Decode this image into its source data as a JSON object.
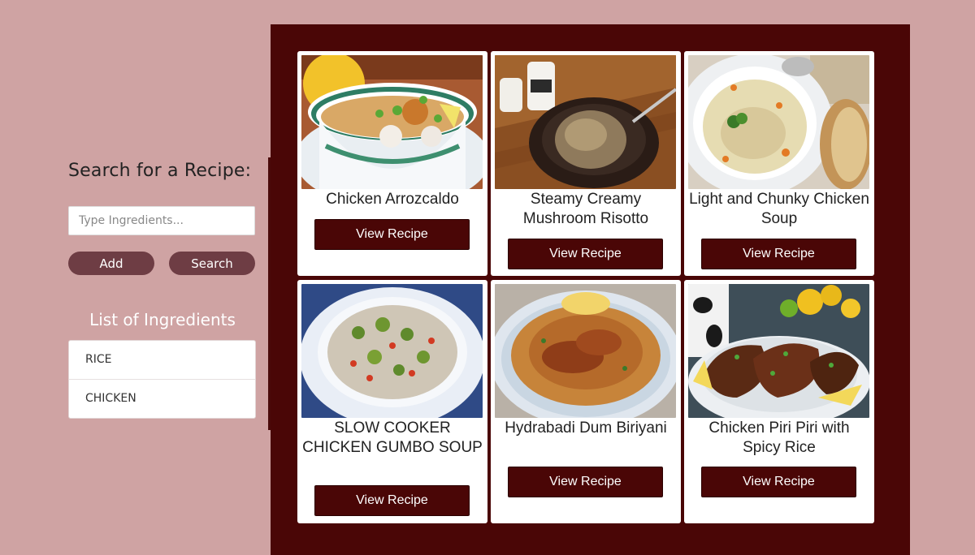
{
  "sidebar": {
    "heading": "Search for a Recipe:",
    "search_placeholder": "Type Ingredients...",
    "search_value": "",
    "add_label": "Add",
    "search_label": "Search",
    "ingredients_heading": "List of Ingredients",
    "ingredients": [
      "RICE",
      "CHICKEN"
    ]
  },
  "recipes": [
    {
      "title": "Chicken Arrozcaldo",
      "button": "View Recipe",
      "image": "congee-bowl"
    },
    {
      "title": "Steamy Creamy Mushroom Risotto",
      "button": "View Recipe",
      "image": "risotto-bowl"
    },
    {
      "title": "Light and Chunky Chicken Soup",
      "button": "View Recipe",
      "image": "chicken-soup-bowl"
    },
    {
      "title": "SLOW COOKER CHICKEN GUMBO SOUP",
      "button": "View Recipe",
      "image": "gumbo-plate"
    },
    {
      "title": "Hydrabadi Dum Biriyani",
      "button": "View Recipe",
      "image": "biryani-plate"
    },
    {
      "title": "Chicken Piri Piri with Spicy Rice",
      "button": "View Recipe",
      "image": "grilled-chicken-plate"
    }
  ],
  "colors": {
    "page_background": "#cfa3a3",
    "panel_background": "#4a0606",
    "pill_button": "#6e3d44"
  }
}
